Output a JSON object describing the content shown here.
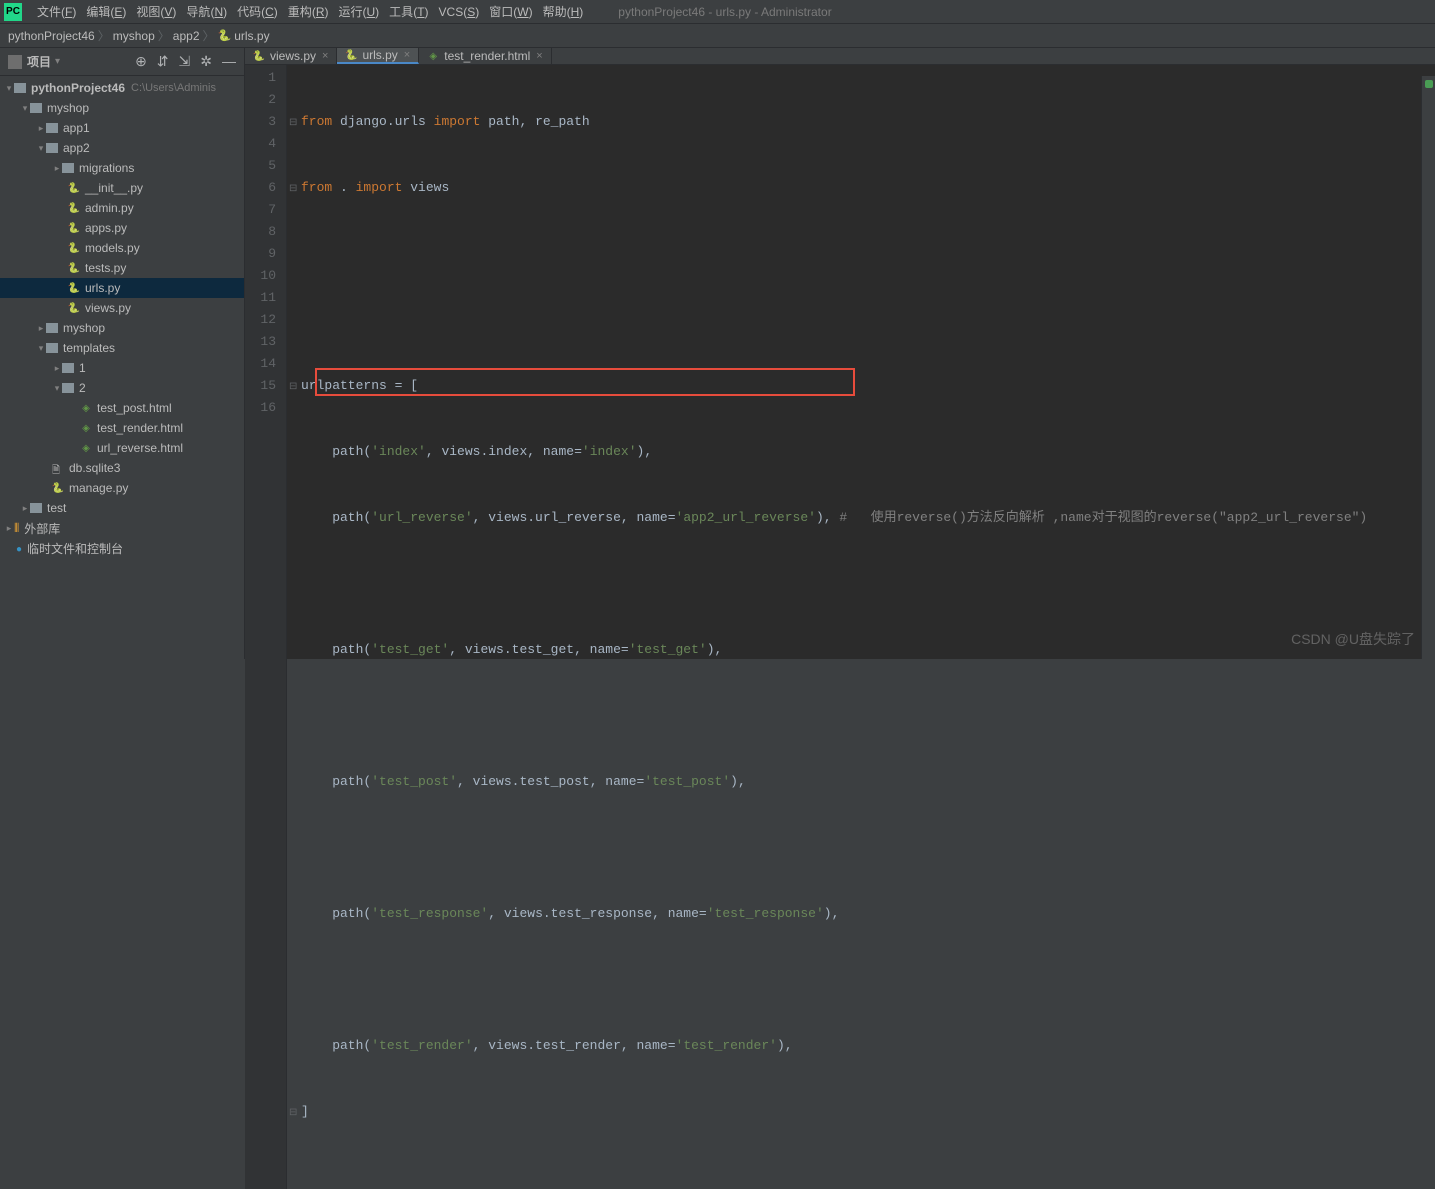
{
  "app": {
    "logo": "PC",
    "title": "pythonProject46 - urls.py - Administrator"
  },
  "menu": [
    {
      "label": "文件",
      "key": "F"
    },
    {
      "label": "编辑",
      "key": "E"
    },
    {
      "label": "视图",
      "key": "V"
    },
    {
      "label": "导航",
      "key": "N"
    },
    {
      "label": "代码",
      "key": "C"
    },
    {
      "label": "重构",
      "key": "R"
    },
    {
      "label": "运行",
      "key": "U"
    },
    {
      "label": "工具",
      "key": "T"
    },
    {
      "label": "VCS",
      "key": "S"
    },
    {
      "label": "窗口",
      "key": "W"
    },
    {
      "label": "帮助",
      "key": "H"
    }
  ],
  "breadcrumbs": [
    "pythonProject46",
    "myshop",
    "app2",
    "urls.py"
  ],
  "sidebar": {
    "title": "项目",
    "tools": {
      "target": "⊕",
      "collapse": "⇵",
      "expand": "⇲",
      "settings": "✲",
      "hide": "—"
    }
  },
  "tree": {
    "root": {
      "name": "pythonProject46",
      "hint": "C:\\Users\\Adminis"
    },
    "myshop": "myshop",
    "app1": "app1",
    "app2": "app2",
    "migrations": "migrations",
    "init": "__init__.py",
    "admin": "admin.py",
    "apps": "apps.py",
    "models": "models.py",
    "tests": "tests.py",
    "urls": "urls.py",
    "views": "views.py",
    "myshop2": "myshop",
    "templates": "templates",
    "t1": "1",
    "t2": "2",
    "test_post": "test_post.html",
    "test_render": "test_render.html",
    "url_reverse": "url_reverse.html",
    "db": "db.sqlite3",
    "manage": "manage.py",
    "test": "test",
    "extlib": "外部库",
    "scratch": "临时文件和控制台"
  },
  "tabs": [
    {
      "label": "views.py",
      "type": "py",
      "active": false
    },
    {
      "label": "urls.py",
      "type": "py",
      "active": true
    },
    {
      "label": "test_render.html",
      "type": "html",
      "active": false
    }
  ],
  "code": {
    "lines": [
      "1",
      "2",
      "3",
      "4",
      "5",
      "6",
      "7",
      "8",
      "9",
      "10",
      "11",
      "12",
      "13",
      "14",
      "15",
      "16"
    ],
    "l1": {
      "a": "from ",
      "b": "django.urls ",
      "c": "import ",
      "d": "path",
      "e": ", ",
      "f": "re_path"
    },
    "l2": {
      "a": "from ",
      "b": ". ",
      "c": "import ",
      "d": "views"
    },
    "l5": {
      "a": "urlpatterns = ["
    },
    "l6": {
      "a": "    path(",
      "b": "'index'",
      "c": ", ",
      "d": "views.index",
      "e": ", ",
      "f": "name",
      "g": "=",
      "h": "'index'",
      "i": "),"
    },
    "l7": {
      "a": "    path(",
      "b": "'url_reverse'",
      "c": ", ",
      "d": "views.url_reverse",
      "e": ", ",
      "f": "name",
      "g": "=",
      "h": "'app2_url_reverse'",
      "i": "), ",
      "j": "#   使用reverse()方法反向解析 ,name对于视图的reverse(\"app2_url_reverse\")"
    },
    "l9": {
      "a": "    path(",
      "b": "'test_get'",
      "c": ", ",
      "d": "views.test_get",
      "e": ", ",
      "f": "name",
      "g": "=",
      "h": "'test_get'",
      "i": "),"
    },
    "l11": {
      "a": "    path(",
      "b": "'test_post'",
      "c": ", ",
      "d": "views.test_post",
      "e": ", ",
      "f": "name",
      "g": "=",
      "h": "'test_post'",
      "i": "),"
    },
    "l13": {
      "a": "    path(",
      "b": "'test_response'",
      "c": ", ",
      "d": "views.test_response",
      "e": ", ",
      "f": "name",
      "g": "=",
      "h": "'test_response'",
      "i": "),"
    },
    "l15": {
      "a": "    path(",
      "b": "'test_render'",
      "c": ", ",
      "d": "views.test_render",
      "e": ", ",
      "f": "name",
      "g": "=",
      "h": "'test_render'",
      "i": "),"
    },
    "l16": {
      "a": "]"
    }
  },
  "watermark": "CSDN @U盘失踪了"
}
